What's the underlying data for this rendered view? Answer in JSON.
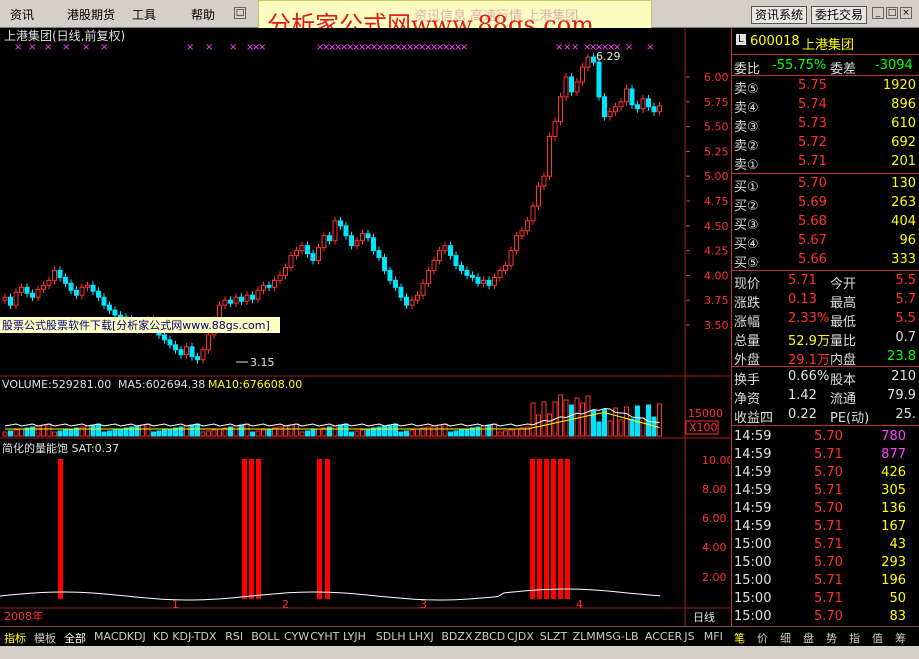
{
  "menu": {
    "items": [
      "资讯",
      "港股期货",
      "工具",
      "帮助"
    ],
    "right_buttons": [
      "资讯系统",
      "委托交易"
    ]
  },
  "banner": {
    "text": "分析家公式网www.88gs.com",
    "ghost_text": "资讯信息 高速行情 上港集团"
  },
  "chart": {
    "title": "上港集团(日线,前复权)",
    "price_ticks": [
      "6.00",
      "5.75",
      "5.50",
      "5.25",
      "5.00",
      "4.75",
      "4.50",
      "4.25",
      "4.00",
      "3.75",
      "3.50"
    ],
    "high_label": "6.29",
    "low_label": "3.15",
    "ad_text": "股票公式股票软件下载[分析家公式网www.88gs.com]",
    "volume": {
      "label": "VOLUME:529281.00",
      "ma5": "MA5:602694.38",
      "ma10": "MA10:676608.00",
      "tick": "15000",
      "unit": "X100"
    },
    "indicator": {
      "label": "简化的量能饱  SAT:0.37",
      "ticks": [
        "10.00",
        "8.00",
        "6.00",
        "4.00",
        "2.00"
      ]
    },
    "x_axis": {
      "labels": [
        "2008年",
        "1",
        "2",
        "3",
        "4"
      ],
      "period": "日线"
    },
    "colors": {
      "up": "#ff3030",
      "down": "#00e5ff",
      "ma10": "#ffff00",
      "ma5": "#ffffff",
      "indicator_bar": "#ff0000",
      "marker": "#ff40ff"
    }
  },
  "quote": {
    "code": "600018",
    "name": "上港集团",
    "wei_bi_label": "委比",
    "wei_bi": "-55.75%",
    "wei_cha_label": "委差",
    "wei_cha": "-3094",
    "sell": [
      {
        "label": "卖⑤",
        "price": "5.75",
        "vol": "1920"
      },
      {
        "label": "卖④",
        "price": "5.74",
        "vol": "896"
      },
      {
        "label": "卖③",
        "price": "5.73",
        "vol": "610"
      },
      {
        "label": "卖②",
        "price": "5.72",
        "vol": "692"
      },
      {
        "label": "卖①",
        "price": "5.71",
        "vol": "201"
      }
    ],
    "buy": [
      {
        "label": "买①",
        "price": "5.70",
        "vol": "130"
      },
      {
        "label": "买②",
        "price": "5.69",
        "vol": "263"
      },
      {
        "label": "买③",
        "price": "5.68",
        "vol": "404"
      },
      {
        "label": "买④",
        "price": "5.67",
        "vol": "96"
      },
      {
        "label": "买⑤",
        "price": "5.66",
        "vol": "333"
      }
    ],
    "stats": [
      {
        "l1": "现价",
        "v1": "5.71",
        "l2": "今开",
        "v2": "5.5"
      },
      {
        "l1": "涨跌",
        "v1": "0.13",
        "l2": "最高",
        "v2": "5.7"
      },
      {
        "l1": "涨幅",
        "v1": "2.33%",
        "l2": "最低",
        "v2": "5.5"
      },
      {
        "l1": "总量",
        "v1": "52.9万",
        "l2": "量比",
        "v2": "0.7"
      },
      {
        "l1": "外盘",
        "v1": "29.1万",
        "l2": "内盘",
        "v2": "23.8"
      }
    ],
    "fundamentals": [
      {
        "l1": "换手",
        "v1": "0.66%",
        "l2": "股本",
        "v2": "210"
      },
      {
        "l1": "净资",
        "v1": "1.42",
        "l2": "流通",
        "v2": "79.9"
      },
      {
        "l1": "收益四",
        "v1": "0.22",
        "l2": "PE(动)",
        "v2": "25."
      }
    ],
    "ticks": [
      {
        "time": "14:59",
        "price": "5.70",
        "vol": "780"
      },
      {
        "time": "14:59",
        "price": "5.71",
        "vol": "877"
      },
      {
        "time": "14:59",
        "price": "5.70",
        "vol": "426"
      },
      {
        "time": "14:59",
        "price": "5.71",
        "vol": "305"
      },
      {
        "time": "14:59",
        "price": "5.70",
        "vol": "136"
      },
      {
        "time": "14:59",
        "price": "5.71",
        "vol": "167"
      },
      {
        "time": "15:00",
        "price": "5.71",
        "vol": "43"
      },
      {
        "time": "15:00",
        "price": "5.70",
        "vol": "293"
      },
      {
        "time": "15:00",
        "price": "5.71",
        "vol": "196"
      },
      {
        "time": "15:00",
        "price": "5.71",
        "vol": "50"
      },
      {
        "time": "15:00",
        "price": "5.70",
        "vol": "83"
      }
    ]
  },
  "tabs": {
    "indicator_tabs": [
      "指标",
      "模板",
      "全部",
      "MACD",
      "KDJ",
      "KD",
      "KDJ-TDX",
      "RSI",
      "BOLL",
      "CYW",
      "CYHT",
      "LYJH",
      "SDLH",
      "LHXJ",
      "BDZX",
      "ZBCD",
      "CJDX",
      "SLZT",
      "ZLMM",
      "SG-LB",
      "ACCER",
      "JS",
      "MFI"
    ],
    "right_tabs": [
      "笔",
      "价",
      "细",
      "盘",
      "势",
      "指",
      "值",
      "筹"
    ]
  }
}
